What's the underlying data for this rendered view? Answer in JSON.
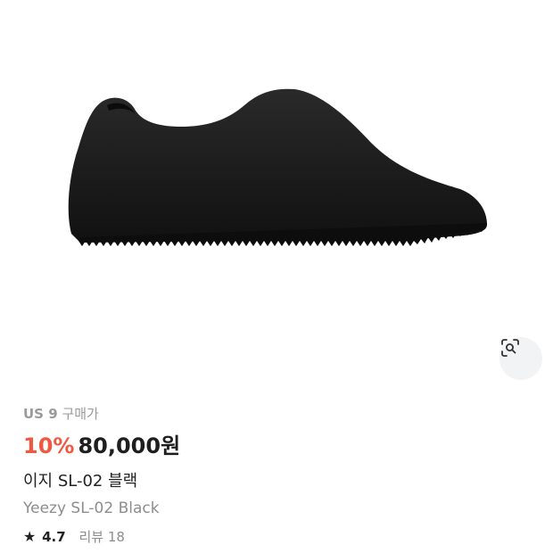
{
  "product": {
    "size": "US 9",
    "purchase_label": "구매가",
    "discount": "10%",
    "price": "80,000원",
    "name_ko": "이지 SL-02 블랙",
    "name_en": "Yeezy SL-02 Black",
    "rating": {
      "star_glyph": "★",
      "score": "4.7",
      "reviews": "리뷰 18"
    }
  },
  "image_search": {
    "icon": "lens-search-icon"
  },
  "colors": {
    "discount": "#ef5941",
    "shoe": "#1a1a1a",
    "lens_button_bg": "#f2f3f5"
  }
}
